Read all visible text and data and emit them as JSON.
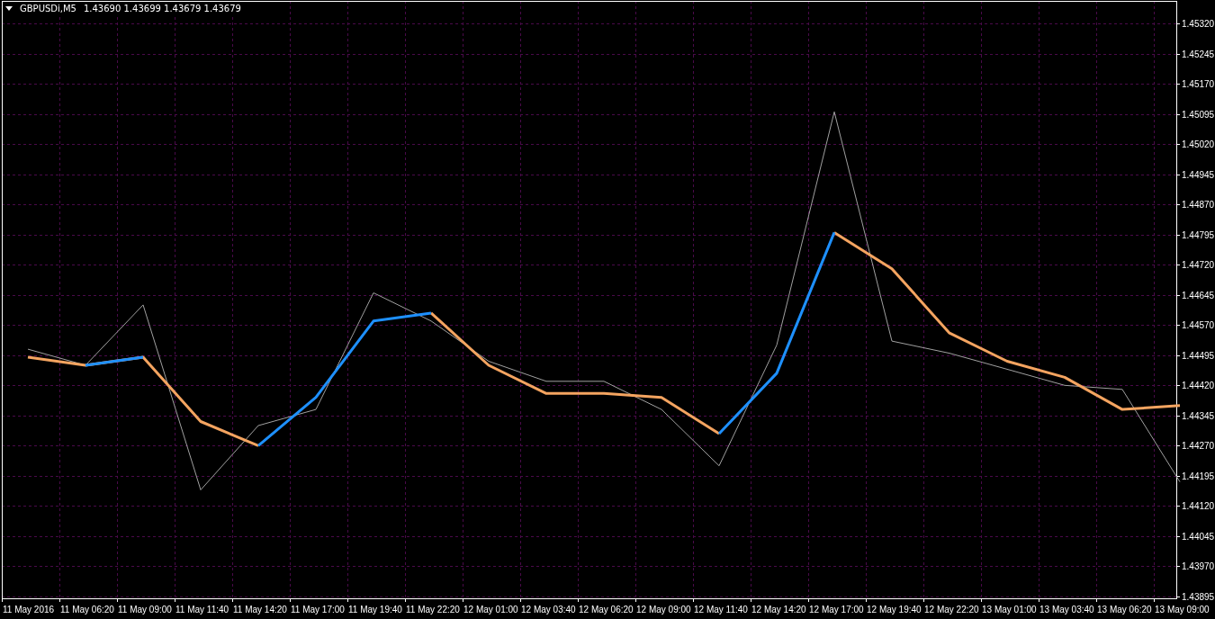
{
  "chart_header": {
    "symbol": "GBPUSDi,M5",
    "quotes": "1.43690 1.43699 1.43679 1.43679"
  },
  "chart": {
    "chart_data": {
      "type": "line",
      "grid": true,
      "categories": [
        "11 May 2016",
        "11 May 06:20",
        "11 May 09:00",
        "11 May 11:40",
        "11 May 14:20",
        "11 May 17:00",
        "11 May 19:40",
        "11 May 22:20",
        "12 May 01:00",
        "12 May 03:40",
        "12 May 06:20",
        "12 May 09:00",
        "12 May 11:40",
        "12 May 14:20",
        "12 May 17:00",
        "12 May 19:40",
        "12 May 22:20",
        "13 May 01:00",
        "13 May 03:40",
        "13 May 06:20",
        "13 May 09:00"
      ],
      "ylim": [
        1.43895,
        1.4532
      ],
      "yticks": [
        {
          "value": 1.4532,
          "label": "1.45320"
        },
        {
          "value": 1.45245,
          "label": "1.45245"
        },
        {
          "value": 1.4517,
          "label": "1.45170"
        },
        {
          "value": 1.45095,
          "label": "1.45095"
        },
        {
          "value": 1.4502,
          "label": "1.45020"
        },
        {
          "value": 1.44945,
          "label": "1.44945"
        },
        {
          "value": 1.4487,
          "label": "1.44870"
        },
        {
          "value": 1.44795,
          "label": "1.44795"
        },
        {
          "value": 1.4472,
          "label": "1.44720"
        },
        {
          "value": 1.44645,
          "label": "1.44645"
        },
        {
          "value": 1.4457,
          "label": "1.44570"
        },
        {
          "value": 1.44495,
          "label": "1.44495"
        },
        {
          "value": 1.4442,
          "label": "1.44420"
        },
        {
          "value": 1.44345,
          "label": "1.44345"
        },
        {
          "value": 1.4427,
          "label": "1.44270"
        },
        {
          "value": 1.44195,
          "label": "1.44195"
        },
        {
          "value": 1.4412,
          "label": "1.44120"
        },
        {
          "value": 1.44045,
          "label": "1.44045"
        },
        {
          "value": 1.4397,
          "label": "1.43970"
        },
        {
          "value": 1.43895,
          "label": "1.43895"
        }
      ],
      "series": [
        {
          "color": "#a0a0a0",
          "values": [
            1.4451,
            1.4447,
            1.4462,
            1.4416,
            1.4432,
            1.4436,
            1.4465,
            1.4458,
            1.4448,
            1.4443,
            1.4443,
            1.4436,
            1.4422,
            1.4452,
            1.451,
            1.4453,
            1.445,
            1.4446,
            1.4442,
            1.4441,
            1.4418
          ]
        },
        {
          "color": "#f4a460",
          "values": [
            1.4449,
            1.4447,
            1.4449,
            1.4433,
            1.4427,
            null,
            null,
            1.446,
            1.4447,
            1.444,
            1.444,
            1.4439,
            1.443,
            null,
            1.448,
            1.4471,
            1.4455,
            1.4448,
            1.4444,
            1.4436,
            1.4437
          ]
        },
        {
          "color": "#1e90ff",
          "values": [
            null,
            1.4447,
            1.4449,
            null,
            1.4427,
            1.4439,
            1.4458,
            1.446,
            null,
            null,
            null,
            null,
            1.443,
            1.4445,
            1.448,
            null,
            null,
            null,
            null,
            null,
            null
          ]
        }
      ]
    }
  }
}
